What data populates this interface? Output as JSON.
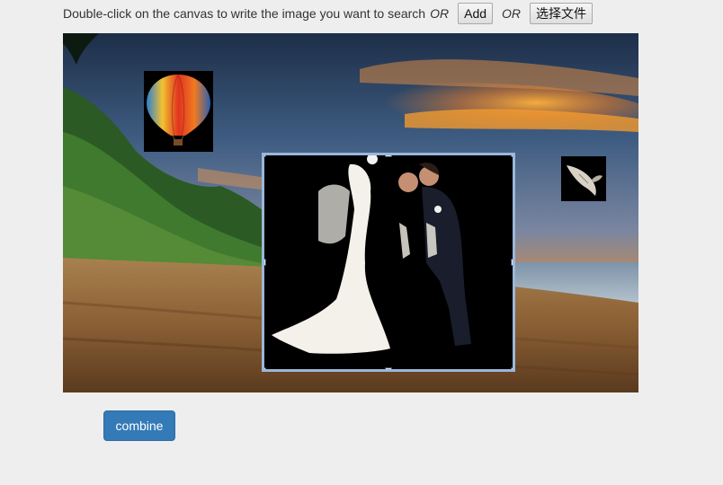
{
  "toolbar": {
    "instruction": "Double-click on the canvas to write the image you want to search",
    "or_1": "OR",
    "add_label": "Add",
    "or_2": "OR",
    "choose_file_label": "选择文件"
  },
  "canvas": {
    "background_image": "beach-sunset-scene",
    "objects": [
      {
        "name": "hot-air-balloon-image"
      },
      {
        "name": "wedding-couple-image",
        "selected": true
      },
      {
        "name": "flying-bird-image"
      }
    ]
  },
  "actions": {
    "combine_label": "combine"
  },
  "colors": {
    "primary_button": "#337ab7",
    "selection_border": "#9bb7d9",
    "page_background": "#eeeeee"
  }
}
